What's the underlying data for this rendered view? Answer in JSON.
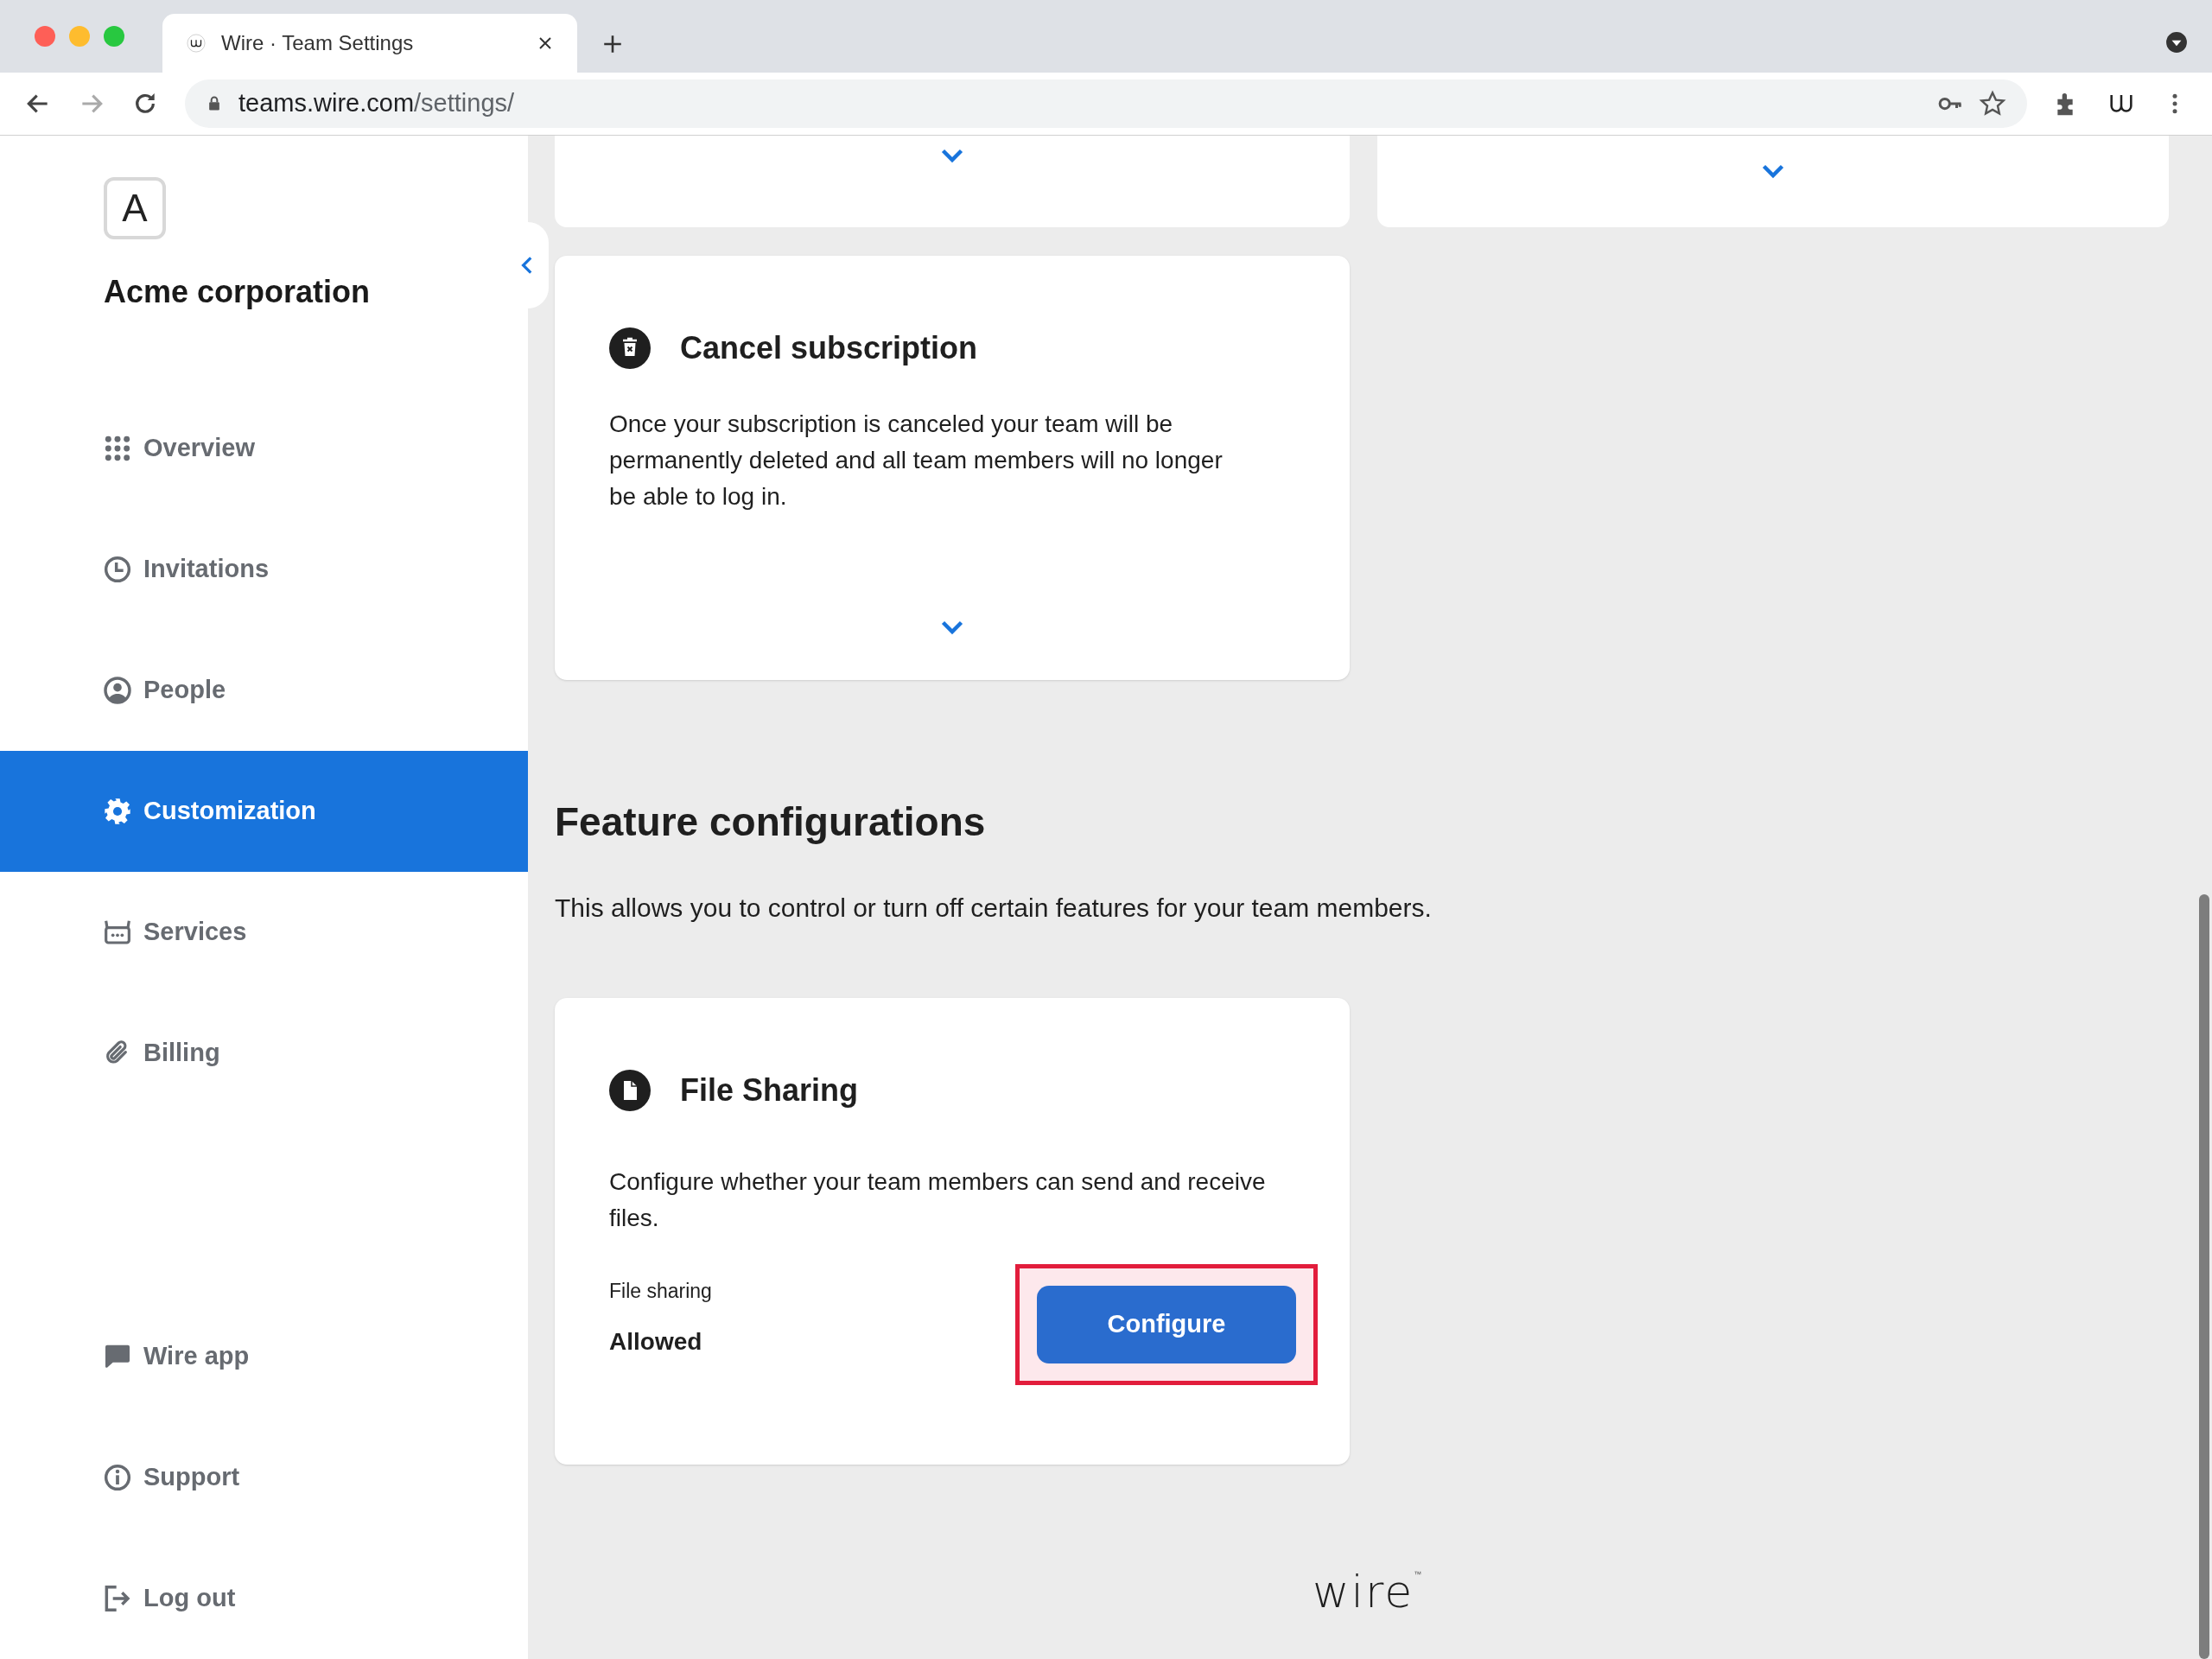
{
  "browser": {
    "tab": {
      "title": "Wire · Team Settings"
    },
    "url": {
      "host": "teams.wire.com",
      "path": "/settings/"
    }
  },
  "sidebar": {
    "team_initial": "A",
    "team_name": "Acme corporation",
    "nav_items": [
      {
        "label": "Overview",
        "selected": false
      },
      {
        "label": "Invitations",
        "selected": false
      },
      {
        "label": "People",
        "selected": false
      },
      {
        "label": "Customization",
        "selected": true
      },
      {
        "label": "Services",
        "selected": false
      },
      {
        "label": "Billing",
        "selected": false
      }
    ],
    "footer_items": [
      {
        "label": "Wire app"
      },
      {
        "label": "Support"
      },
      {
        "label": "Log out"
      }
    ]
  },
  "cancel_card": {
    "title": "Cancel subscription",
    "description": "Once your subscription is canceled your team will be permanently deleted and all team members will no longer be able to log in."
  },
  "feature_section": {
    "title": "Feature configurations",
    "description": "This allows you to control or turn off certain features for your team members."
  },
  "feature_card": {
    "title": "File Sharing",
    "description": "Configure whether your team members can send and receive files.",
    "setting_label": "File sharing",
    "setting_value": "Allowed",
    "button": "Configure",
    "highlighted": true
  },
  "footer_logo": {
    "text": "wire",
    "mark": "™"
  }
}
